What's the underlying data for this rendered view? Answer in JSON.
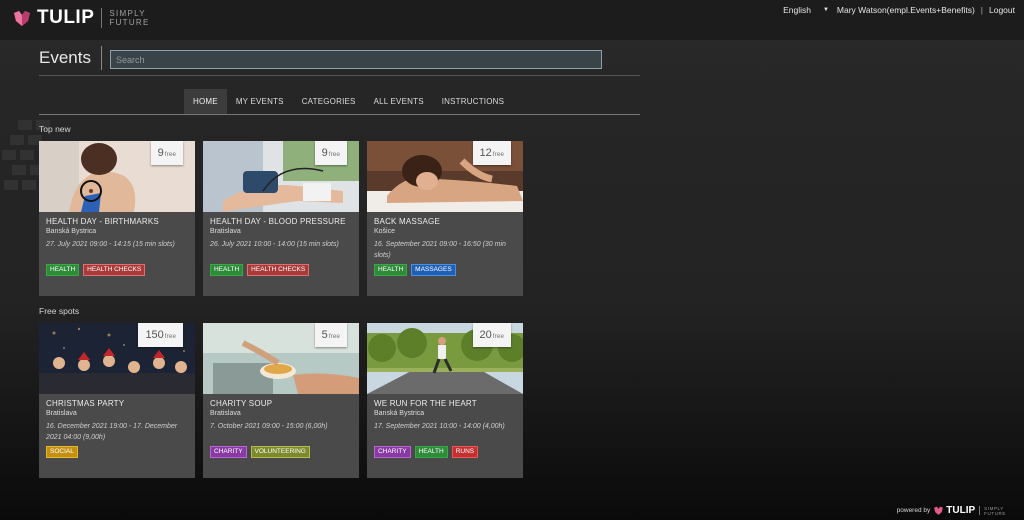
{
  "brand": {
    "name": "TULIP",
    "tagline_1": "SIMPLY",
    "tagline_2": "FUTURE"
  },
  "topnav": {
    "language": "English",
    "user": "Mary Watson(empl.Events+Benefits)",
    "logout": "Logout"
  },
  "header": {
    "title": "Events",
    "search_placeholder": "Search"
  },
  "tabs": [
    {
      "label": "HOME",
      "active": true
    },
    {
      "label": "MY EVENTS"
    },
    {
      "label": "CATEGORIES"
    },
    {
      "label": "ALL EVENTS"
    },
    {
      "label": "INSTRUCTIONS"
    }
  ],
  "sections": [
    {
      "title": "Top new",
      "cards": [
        {
          "free_count": "9",
          "free_label": "free",
          "title": "HEALTH DAY - BIRTHMARKS",
          "city": "Banská Bystrica",
          "date": "27. July 2021 09:00 - 14:15 (15 min slots)",
          "tags": [
            {
              "label": "HEALTH",
              "color": "#39a845"
            },
            {
              "label": "HEALTH CHECKS",
              "color": "#c84a4a"
            }
          ]
        },
        {
          "free_count": "9",
          "free_label": "free",
          "title": "HEALTH DAY - BLOOD PRESSURE",
          "city": "Bratislava",
          "date": "26. July 2021 10:00 - 14:00 (15 min slots)",
          "tags": [
            {
              "label": "HEALTH",
              "color": "#39a845"
            },
            {
              "label": "HEALTH CHECKS",
              "color": "#c84a4a"
            }
          ]
        },
        {
          "free_count": "12",
          "free_label": "free",
          "title": "BACK MASSAGE",
          "city": "Košice",
          "date": "16. September 2021 09:00 - 16:50 (30 min slots)",
          "tags": [
            {
              "label": "HEALTH",
              "color": "#39a845"
            },
            {
              "label": "MASSAGES",
              "color": "#1f6fd1"
            }
          ]
        }
      ]
    },
    {
      "title": "Free spots",
      "cards": [
        {
          "free_count": "150",
          "free_label": "free",
          "title": "CHRISTMAS PARTY",
          "city": "Bratislava",
          "date": "16. December 2021 19:00 - 17. December 2021 04:00 (9,00h)",
          "tags": [
            {
              "label": "SOCIAL",
              "color": "#d4a017"
            }
          ]
        },
        {
          "free_count": "5",
          "free_label": "free",
          "title": "CHARITY SOUP",
          "city": "Bratislava",
          "date": "7. October 2021 09:00 - 15:00 (6,00h)",
          "tags": [
            {
              "label": "CHARITY",
              "color": "#9b45b5"
            },
            {
              "label": "VOLUNTEERING",
              "color": "#8f9a35"
            }
          ]
        },
        {
          "free_count": "20",
          "free_label": "free",
          "title": "WE RUN FOR THE HEART",
          "city": "Banská Bystrica",
          "date": "17. September 2021 10:00 - 14:00 (4,00h)",
          "tags": [
            {
              "label": "CHARITY",
              "color": "#9b45b5"
            },
            {
              "label": "HEALTH",
              "color": "#39a845"
            },
            {
              "label": "RUNS",
              "color": "#d03a3a"
            }
          ]
        }
      ]
    }
  ],
  "footer": {
    "powered_by": "powered by",
    "brand": "TULIP",
    "tagline_1": "SIMPLY",
    "tagline_2": "FUTURE"
  },
  "colors": {
    "accent_logo": "#e25a8a",
    "card_bg": "#4a4a4a",
    "search_border": "#8aa4ad"
  }
}
